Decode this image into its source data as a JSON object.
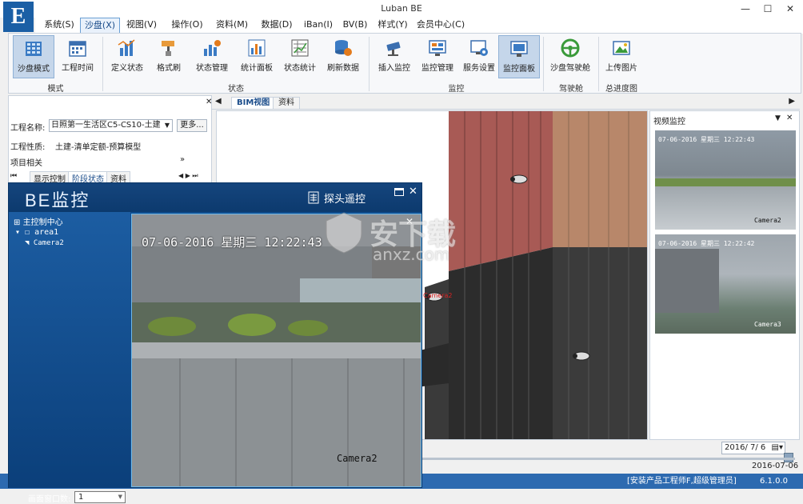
{
  "window": {
    "title": "Luban BE",
    "logo_text": "E",
    "controls": {
      "minimize": "—",
      "maximize": "☐",
      "close": "✕"
    }
  },
  "menu": [
    {
      "label": "系统(S)"
    },
    {
      "label": "沙盘(X)",
      "active": true
    },
    {
      "label": "视图(V)"
    },
    {
      "label": "操作(O)"
    },
    {
      "label": "资料(M)"
    },
    {
      "label": "数据(D)"
    },
    {
      "label": "iBan(I)"
    },
    {
      "label": "BV(B)"
    },
    {
      "label": "样式(Y)"
    },
    {
      "label": "会员中心(C)"
    }
  ],
  "ribbon": {
    "buttons": [
      {
        "label": "沙盘模式",
        "icon": "sandbox-mode-icon",
        "active": true
      },
      {
        "label": "工程时间",
        "icon": "calendar-icon"
      },
      {
        "label": "定义状态",
        "icon": "define-status-icon"
      },
      {
        "label": "格式刷",
        "icon": "format-brush-icon"
      },
      {
        "label": "状态管理",
        "icon": "status-manage-icon"
      },
      {
        "label": "统计面板",
        "icon": "stats-panel-icon"
      },
      {
        "label": "状态统计",
        "icon": "status-stats-icon"
      },
      {
        "label": "刷新数据",
        "icon": "refresh-data-icon"
      },
      {
        "label": "插入监控",
        "icon": "insert-camera-icon"
      },
      {
        "label": "监控管理",
        "icon": "camera-manage-icon"
      },
      {
        "label": "服务设置",
        "icon": "service-settings-icon"
      },
      {
        "label": "监控面板",
        "icon": "monitor-panel-icon",
        "active": true
      },
      {
        "label": "沙盘驾驶舱",
        "icon": "steering-wheel-icon"
      },
      {
        "label": "上传图片",
        "icon": "upload-image-icon"
      }
    ],
    "groups": [
      "模式",
      "状态",
      "监控",
      "驾驶舱",
      "总进度图"
    ]
  },
  "left_panel": {
    "project_name_label": "工程名称:",
    "project_name_value": "日照第一生活区C5-CS10-土建",
    "more_button": "更多...",
    "project_type_label": "工程性质:",
    "project_type_value": "土建-清单定额-预算模型",
    "related_label": "项目相关",
    "tabs": [
      "显示控制",
      "阶段状态",
      "资料"
    ],
    "active_tab": "阶段状态"
  },
  "center_tabs": [
    "BIM视图",
    "资料"
  ],
  "video_panel": {
    "title": "视频监控",
    "cameras": [
      {
        "timestamp": "07-06-2016 星期三 12:22:43",
        "name": "Camera2"
      },
      {
        "timestamp": "07-06-2016 星期三 12:22:42",
        "name": "Camera3"
      }
    ]
  },
  "viewport": {
    "camera_labels": [
      "Camera2"
    ]
  },
  "monitor_window": {
    "title": "BE监控",
    "ptz_label": "探头遥控",
    "tree": {
      "root": "主控制中心",
      "area": "area1",
      "camera": "Camera2"
    },
    "video_timestamp": "07-06-2016  星期三  12:22:43",
    "video_camera_name": "Camera2",
    "window_count_label": "画面窗口数:",
    "window_count_value": "1"
  },
  "bottom": {
    "date_input": "2016/ 7/ 6",
    "date_label": "2016-07-06"
  },
  "status_bar": {
    "user": "[安装产品工程师F,超级管理员]",
    "version": "6.1.0.0"
  },
  "watermark": {
    "main": "安下载",
    "sub": "anxz.com"
  },
  "colors": {
    "accent": "#1b5fa5",
    "status_bar": "#2d6ab0",
    "monitor_bg": "#0f4d8e"
  }
}
